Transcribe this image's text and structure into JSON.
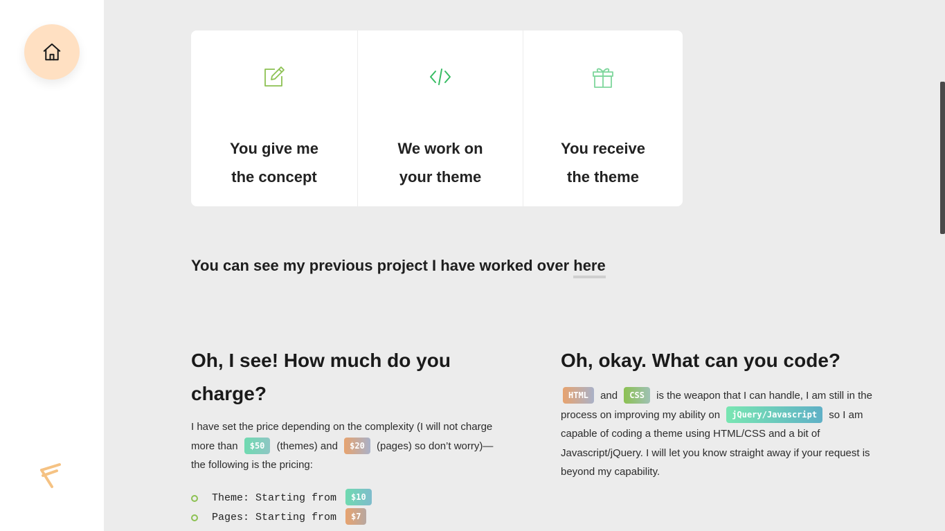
{
  "sidebar": {
    "home_icon": "home-icon",
    "logo_icon": "angle-logo-icon",
    "accent_color": "#ffe0c2"
  },
  "steps": [
    {
      "icon": "edit-icon",
      "line1": "You give me",
      "line2": "the concept",
      "color": "#8cc152"
    },
    {
      "icon": "code-icon",
      "line1": "We work on",
      "line2": "your theme",
      "color": "#37bc63"
    },
    {
      "icon": "gift-icon",
      "line1": "You receive",
      "line2": "the theme",
      "color": "#7ed69c"
    }
  ],
  "previous": {
    "text": "You can see my previous project I have worked over ",
    "link": "here"
  },
  "pricing": {
    "heading": "Oh, I see! How much do you charge?",
    "p1": "I have set the price depending on the complexity (I will not charge more than",
    "badge_themes": "$50",
    "p2": "(themes) and",
    "badge_pages": "$20",
    "p3": "(pages) so don’t worry)—the following is the pricing:",
    "items": [
      {
        "label": "Theme: Starting from",
        "price": "$10"
      },
      {
        "label": "Pages: Starting from",
        "price": "$7"
      }
    ]
  },
  "skills": {
    "heading": "Oh, okay. What can you code?",
    "badge_html": "HTML",
    "and": "and",
    "badge_css": "CSS",
    "t1": "is the weapon that I can handle, I am still in the process on improving my ability on",
    "badge_js": "jQuery/Javascript",
    "t2": "so I am capable of coding a theme using HTML/CSS and a bit of Javascript/jQuery. I will let you know straight away if your request is beyond my capability."
  }
}
